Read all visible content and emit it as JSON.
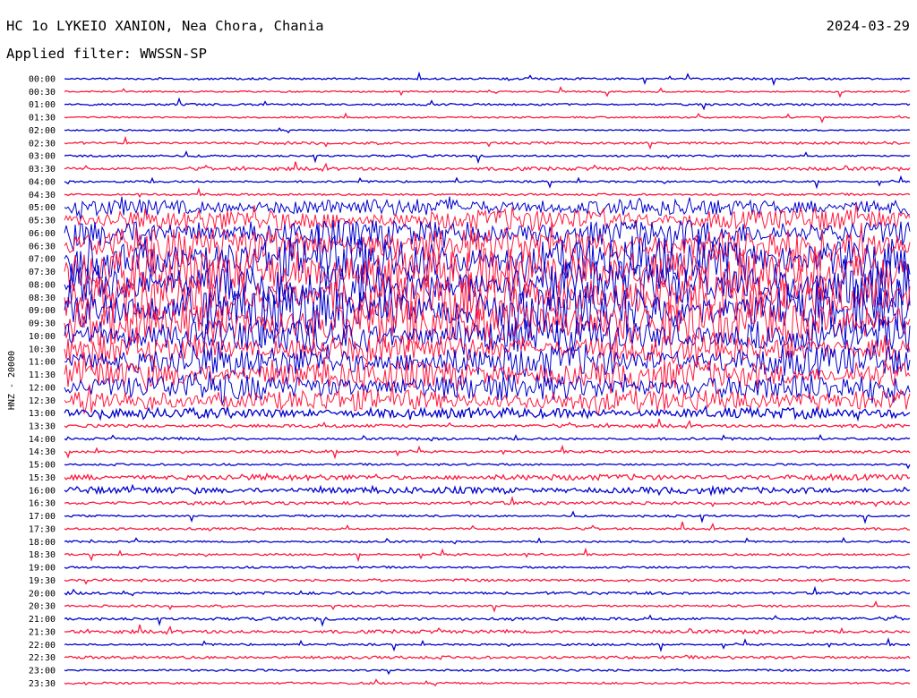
{
  "header": {
    "station": "HC 1o LYKEIO XANION, Nea Chora, Chania",
    "date": "2024-03-29",
    "filter_text": "Applied filter: WWSSN-SP"
  },
  "colors": {
    "trace_a": "#0000cc",
    "trace_b": "#ff1a40",
    "background": "#ffffff"
  },
  "chart_data": {
    "type": "line",
    "title": "HC 1o LYKEIO XANION, Nea Chora, Chania",
    "ylabel": "HNZ - 20000",
    "row_labels": [
      "00:00",
      "00:30",
      "01:00",
      "01:30",
      "02:00",
      "02:30",
      "03:00",
      "03:30",
      "04:00",
      "04:30",
      "05:00",
      "05:30",
      "06:00",
      "06:30",
      "07:00",
      "07:30",
      "08:00",
      "08:30",
      "09:00",
      "09:30",
      "10:00",
      "10:30",
      "11:00",
      "11:30",
      "12:00",
      "12:30",
      "13:00",
      "13:30",
      "14:00",
      "14:30",
      "15:00",
      "15:30",
      "16:00",
      "16:30",
      "17:00",
      "17:30",
      "18:00",
      "18:30",
      "19:00",
      "19:30",
      "20:00",
      "20:30",
      "21:00",
      "21:30",
      "22:00",
      "22:30",
      "23:00",
      "23:30"
    ],
    "row_colors_cycle": [
      "#0000cc",
      "#ff1a40"
    ],
    "activity_levels": [
      0.02,
      0.01,
      0.02,
      0.01,
      0.01,
      0.03,
      0.02,
      0.05,
      0.02,
      0.02,
      0.35,
      0.45,
      0.55,
      0.75,
      0.95,
      1.0,
      1.0,
      1.0,
      1.0,
      0.95,
      0.7,
      0.6,
      0.65,
      0.6,
      0.55,
      0.45,
      0.2,
      0.05,
      0.03,
      0.03,
      0.02,
      0.1,
      0.12,
      0.05,
      0.02,
      0.03,
      0.02,
      0.02,
      0.02,
      0.03,
      0.04,
      0.02,
      0.04,
      0.05,
      0.02,
      0.04,
      0.02,
      0.02
    ]
  }
}
